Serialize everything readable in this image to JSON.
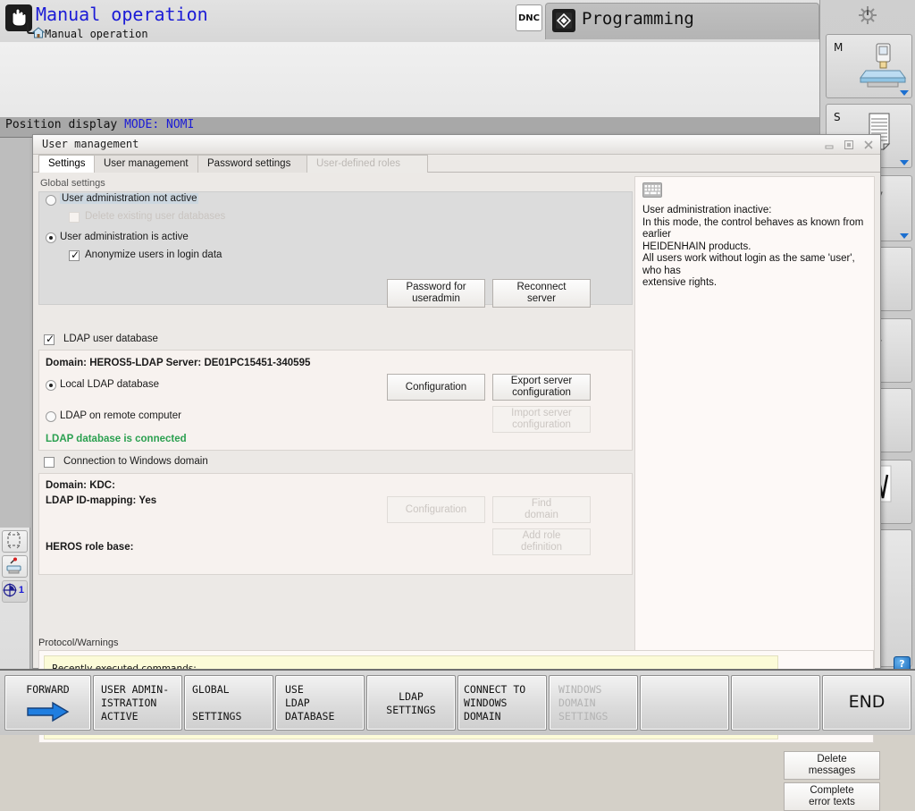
{
  "machine": {
    "mode_title": "Manual operation",
    "mode_breadcrumb": "Manual operation",
    "dnc_badge": "DNC",
    "programming_tab": "Programming",
    "status_strip_prefix": "Position display ",
    "status_strip_mode": "MODE:",
    "status_strip_value": "NOMI",
    "icons": {
      "hand": "hand-icon",
      "home": "home-icon",
      "programming": "programming-diamond-icon",
      "gear": "gear-icon",
      "help": "?"
    },
    "right_rail": [
      {
        "label": "M",
        "icon": "spindle-table-icon",
        "caret": true
      },
      {
        "label": "S",
        "icon": "tool-list-icon",
        "caret": true
      },
      {
        "label": "",
        "icon": "tool-holder-icon",
        "caret": true,
        "marker": "red-arrow"
      },
      {
        "label": "",
        "icon": "",
        "caret": false
      },
      {
        "label": "",
        "icon": "tool-probe-icon",
        "state": "ON"
      },
      {
        "label": "",
        "icon": "",
        "caret": false
      },
      {
        "label": "",
        "icon": "oscillation-icon",
        "state": "ON"
      },
      {
        "label": "",
        "icon": "",
        "caret": false
      }
    ],
    "left_rail": [
      {
        "icon": "workpiece-frame-icon"
      },
      {
        "icon": "table-preset-icon"
      },
      {
        "icon": "datum-icon",
        "value": "1"
      }
    ]
  },
  "dialog": {
    "title": "User management",
    "window_buttons": [
      "minimize-button",
      "maximize-button",
      "close-button"
    ],
    "tabs": [
      {
        "label": "Settings",
        "state": "active"
      },
      {
        "label": "User management",
        "state": "normal"
      },
      {
        "label": "Password settings",
        "state": "normal"
      },
      {
        "label": "User-defined roles",
        "state": "disabled"
      }
    ],
    "global": {
      "group_label": "Global settings",
      "not_active_label": "User administration not active",
      "not_active_selected": false,
      "delete_db_label": "Delete existing user databases",
      "is_active_label": "User administration is active",
      "is_active_selected": true,
      "anonymize_label": "Anonymize users in login data",
      "anonymize_checked": true,
      "btn_password": "Password for\nuseradmin",
      "btn_reconnect": "Reconnect\nserver"
    },
    "ldap": {
      "checkbox_label": "LDAP user database",
      "checkbox_checked": true,
      "domain_line": "Domain: HEROS5-LDAP Server: DE01PC15451-340595",
      "local_label": "Local LDAP database",
      "local_selected": true,
      "remote_label": "LDAP on remote computer",
      "remote_selected": false,
      "status_text": "LDAP database is connected",
      "status_color": "#2ba050",
      "btn_configuration": "Configuration",
      "btn_export": "Export server\nconfiguration",
      "btn_import": "Import server\nconfiguration"
    },
    "windows": {
      "checkbox_label": "Connection to Windows domain",
      "checkbox_checked": false,
      "domain_line": "Domain:  KDC:",
      "idmapping_line": "LDAP ID-mapping: Yes",
      "role_base_line": "HEROS role base:",
      "btn_configuration": "Configuration",
      "btn_find_domain": "Find\ndomain",
      "btn_add_role": "Add role\ndefinition"
    },
    "info": {
      "icon": "keyboard-icon",
      "text": "User administration inactive:\nIn this mode, the control behaves as known from earlier\nHEIDENHAIN products.\nAll users work without login as the same 'user', who has\nextensive rights."
    },
    "protocol": {
      "label": "Protocol/Warnings",
      "text": "Recently executed commands:\nCheck if password for \"useradmin\" is set OK\nCheck if password for \"useradmin\" is set OK\nTest if control has access to an LDAP data base OK\nGet default shadow values OK",
      "btn_delete": "Delete\nmessages",
      "btn_complete": "Complete\nerror texts"
    }
  },
  "softkeys": [
    {
      "label": "FORWARD",
      "icon": "right-arrow-icon",
      "state": "normal"
    },
    {
      "label": "USER ADMIN-\nISTRATION\nACTIVE",
      "state": "normal"
    },
    {
      "label": "GLOBAL\n\nSETTINGS",
      "state": "normal"
    },
    {
      "label": "USE\nLDAP\nDATABASE",
      "state": "normal"
    },
    {
      "label": "LDAP\nSETTINGS",
      "state": "normal"
    },
    {
      "label": "CONNECT TO\nWINDOWS\nDOMAIN",
      "state": "normal"
    },
    {
      "label": "WINDOWS\nDOMAIN\nSETTINGS",
      "state": "disabled"
    },
    {
      "label": "",
      "state": "normal"
    },
    {
      "label": "",
      "state": "normal"
    },
    {
      "label": "END",
      "state": "normal",
      "big": true
    }
  ]
}
